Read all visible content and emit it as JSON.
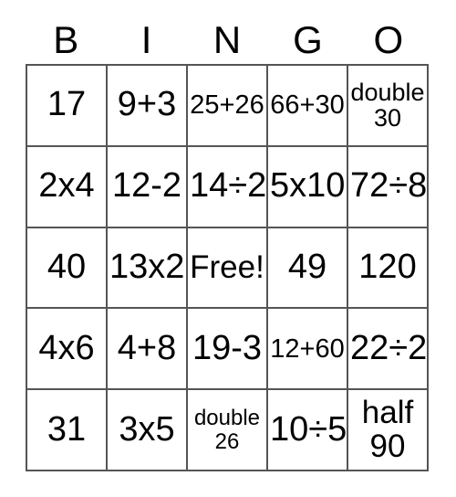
{
  "card": {
    "title": "BINGO",
    "header": {
      "letters": [
        "B",
        "I",
        "N",
        "G",
        "O"
      ]
    },
    "free_space": "Free!",
    "colors": {
      "border": "#555555",
      "text": "#000000",
      "background": "#ffffff"
    },
    "grid": {
      "columns": 5,
      "rows": 5,
      "cells": [
        [
          {
            "text": "17",
            "size": "fs-xl"
          },
          {
            "text": "9+3",
            "size": "fs-xl"
          },
          {
            "text": "25+26",
            "size": "fs-md"
          },
          {
            "text": "66+30",
            "size": "fs-md"
          },
          {
            "text": "double\n30",
            "size": "fs-dbl"
          }
        ],
        [
          {
            "text": "2x4",
            "size": "fs-xl"
          },
          {
            "text": "12-2",
            "size": "fs-xl"
          },
          {
            "text": "14÷2",
            "size": "fs-xl"
          },
          {
            "text": "5x10",
            "size": "fs-xl"
          },
          {
            "text": "72÷8",
            "size": "fs-xl"
          }
        ],
        [
          {
            "text": "40",
            "size": "fs-xl"
          },
          {
            "text": "13x2",
            "size": "fs-xl"
          },
          {
            "text": "Free!",
            "size": "fs-lg"
          },
          {
            "text": "49",
            "size": "fs-xl"
          },
          {
            "text": "120",
            "size": "fs-xl"
          }
        ],
        [
          {
            "text": "4x6",
            "size": "fs-xl"
          },
          {
            "text": "4+8",
            "size": "fs-xl"
          },
          {
            "text": "19-3",
            "size": "fs-xl"
          },
          {
            "text": "12+60",
            "size": "fs-md"
          },
          {
            "text": "22÷2",
            "size": "fs-xl"
          }
        ],
        [
          {
            "text": "31",
            "size": "fs-xl"
          },
          {
            "text": "3x5",
            "size": "fs-xl"
          },
          {
            "text": "double\n26",
            "size": "fs-dbls"
          },
          {
            "text": "10÷5",
            "size": "fs-xl"
          },
          {
            "text": "half\n90",
            "size": "fs-lg"
          }
        ]
      ]
    }
  }
}
